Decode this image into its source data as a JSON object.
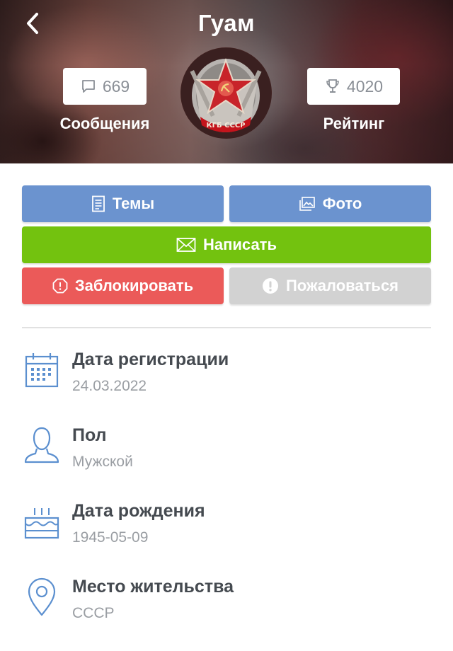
{
  "header": {
    "title": "Гуам",
    "messages_count": "669",
    "messages_label": "Сообщения",
    "rating_count": "4020",
    "rating_label": "Рейтинг",
    "avatar_text": "КГБ СССР"
  },
  "actions": {
    "topics": "Темы",
    "photo": "Фото",
    "write": "Написать",
    "block": "Заблокировать",
    "report": "Пожаловаться"
  },
  "info": [
    {
      "label": "Дата регистрации",
      "value": "24.03.2022",
      "icon": "calendar-icon"
    },
    {
      "label": "Пол",
      "value": "Мужской",
      "icon": "user-icon"
    },
    {
      "label": "Дата рождения",
      "value": "1945-05-09",
      "icon": "cake-icon"
    },
    {
      "label": "Место жительства",
      "value": "СССР",
      "icon": "location-pin-icon"
    }
  ],
  "colors": {
    "primary_blue": "#6b93cf",
    "write_green": "#73c20f",
    "block_red": "#eb5a59",
    "report_gray": "#d2d2d2",
    "icon_blue": "#5b8fcf"
  }
}
